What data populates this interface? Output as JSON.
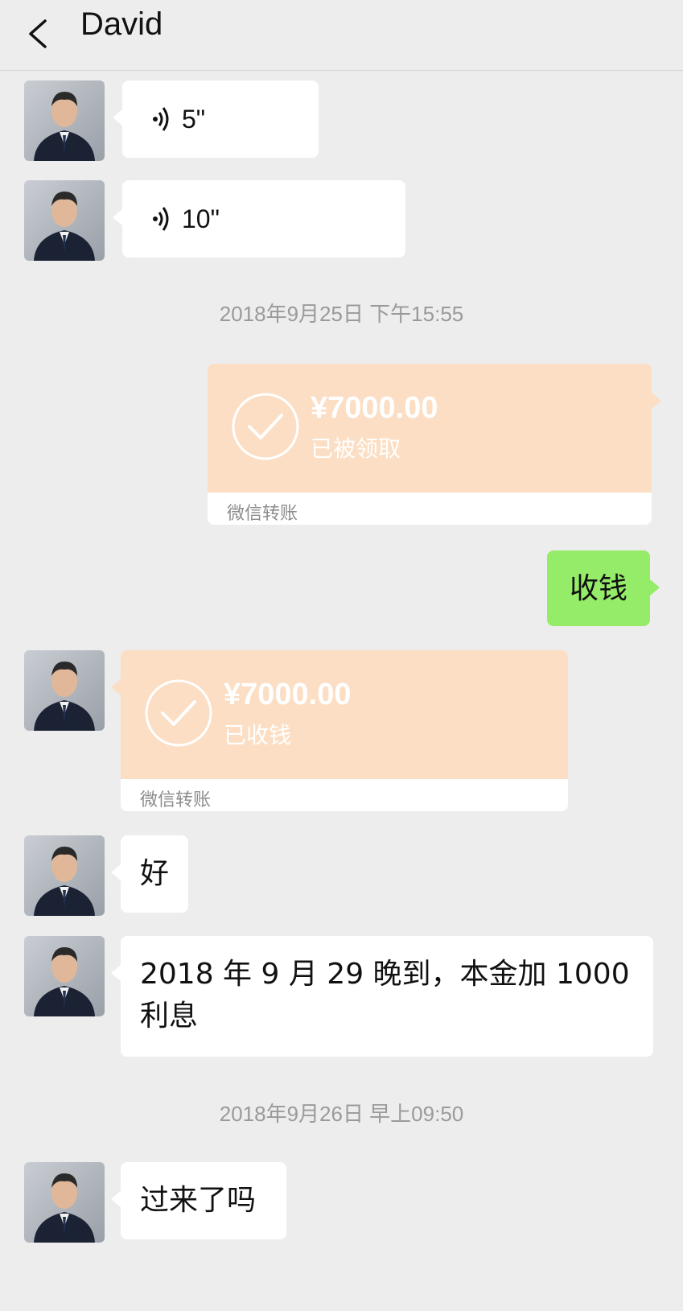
{
  "header": {
    "title": "David",
    "back_icon": "chevron-left-icon"
  },
  "messages": [
    {
      "type": "voice",
      "side": "in",
      "duration": "5\""
    },
    {
      "type": "voice",
      "side": "in",
      "duration": "10\""
    },
    {
      "type": "timestamp",
      "text": "2018年9月25日 下午15:55"
    },
    {
      "type": "transfer",
      "side": "out",
      "amount": "¥7000.00",
      "status": "已被领取",
      "footer": "微信转账"
    },
    {
      "type": "text",
      "side": "out",
      "text": "收钱"
    },
    {
      "type": "transfer",
      "side": "in",
      "amount": "¥7000.00",
      "status": "已收钱",
      "footer": "微信转账"
    },
    {
      "type": "text",
      "side": "in",
      "text": "好"
    },
    {
      "type": "text",
      "side": "in",
      "text": "2018 年 9 月 29 晚到，本金加 1000 利息"
    },
    {
      "type": "timestamp",
      "text": "2018年9月26日 早上09:50"
    },
    {
      "type": "text",
      "side": "in",
      "text": "过来了吗"
    }
  ],
  "colors": {
    "background": "#ededed",
    "outgoing_bubble": "#95ec69",
    "transfer_card": "#fbdec3",
    "timestamp_text": "#9a9a9a"
  }
}
